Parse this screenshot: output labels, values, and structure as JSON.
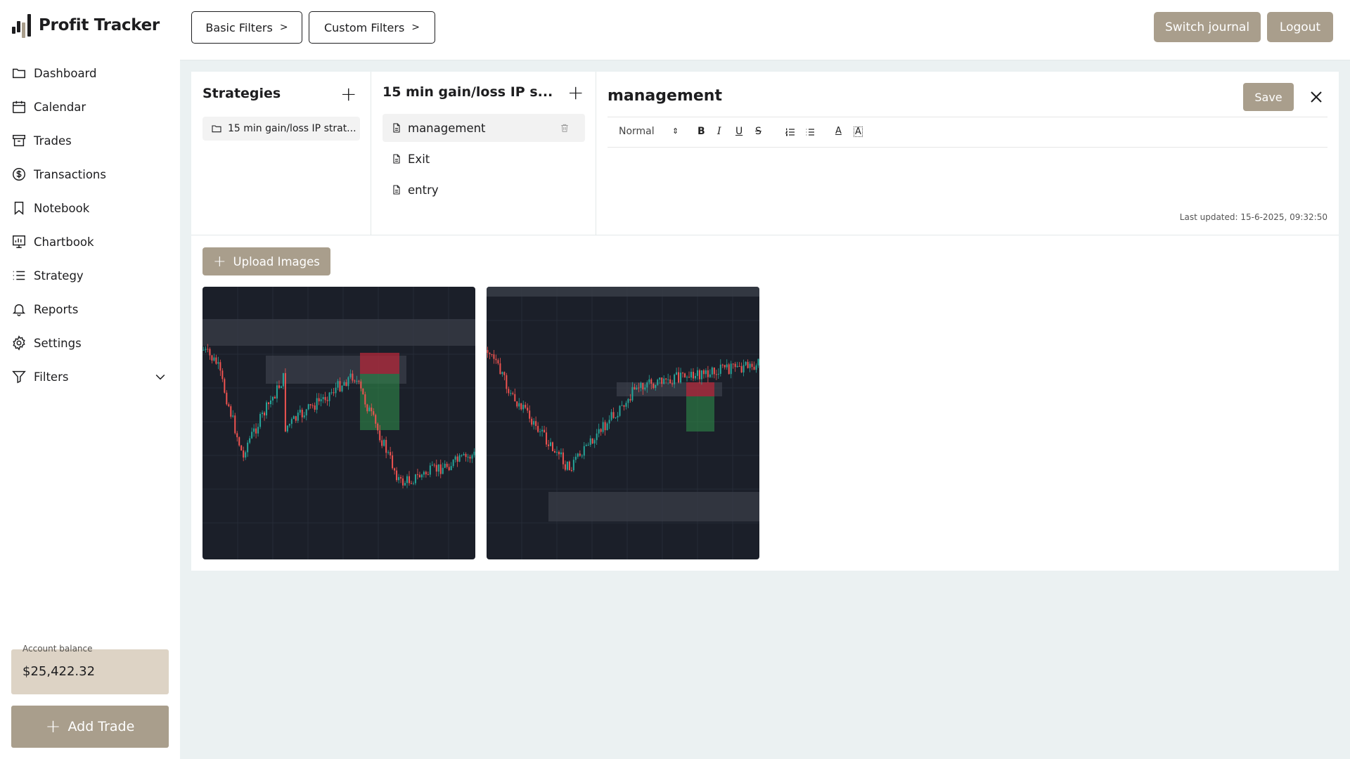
{
  "app": {
    "name": "Profit Tracker"
  },
  "sidebar": {
    "items": [
      {
        "label": "Dashboard",
        "icon": "folder-icon"
      },
      {
        "label": "Calendar",
        "icon": "calendar-icon"
      },
      {
        "label": "Trades",
        "icon": "archive-icon"
      },
      {
        "label": "Transactions",
        "icon": "dollar-circle-icon"
      },
      {
        "label": "Notebook",
        "icon": "bookmark-icon"
      },
      {
        "label": "Chartbook",
        "icon": "chart-board-icon"
      },
      {
        "label": "Strategy",
        "icon": "list-icon"
      },
      {
        "label": "Reports",
        "icon": "bell-icon"
      },
      {
        "label": "Settings",
        "icon": "gear-icon"
      },
      {
        "label": "Filters",
        "icon": "filter-icon"
      }
    ],
    "balance_label": "Account balance",
    "balance_value": "$25,422.32",
    "add_trade_label": "Add Trade"
  },
  "topbar": {
    "basic_filters": "Basic Filters",
    "custom_filters": "Custom Filters",
    "switch_journal": "Switch journal",
    "logout": "Logout"
  },
  "strategies": {
    "title": "Strategies",
    "items": [
      "15 min gain/loss IP strat..."
    ]
  },
  "notes": {
    "title": "15 min gain/loss IP s...",
    "items": [
      "management",
      "Exit",
      "entry"
    ]
  },
  "editor": {
    "title": "management",
    "save_label": "Save",
    "format_select": "Normal",
    "last_updated": "Last updated: 15-6-2025, 09:32:50"
  },
  "gallery": {
    "upload_label": "Upload Images",
    "images": [
      {
        "name": "chart-screenshot-1"
      },
      {
        "name": "chart-screenshot-2"
      }
    ]
  },
  "colors": {
    "accent": "#a99e8c",
    "balance_bg": "#ddd3c5",
    "page_bg": "#ebf1f2",
    "chart_bg": "#1b1f29",
    "candle_up": "#26a69a",
    "candle_down": "#ef5350"
  }
}
